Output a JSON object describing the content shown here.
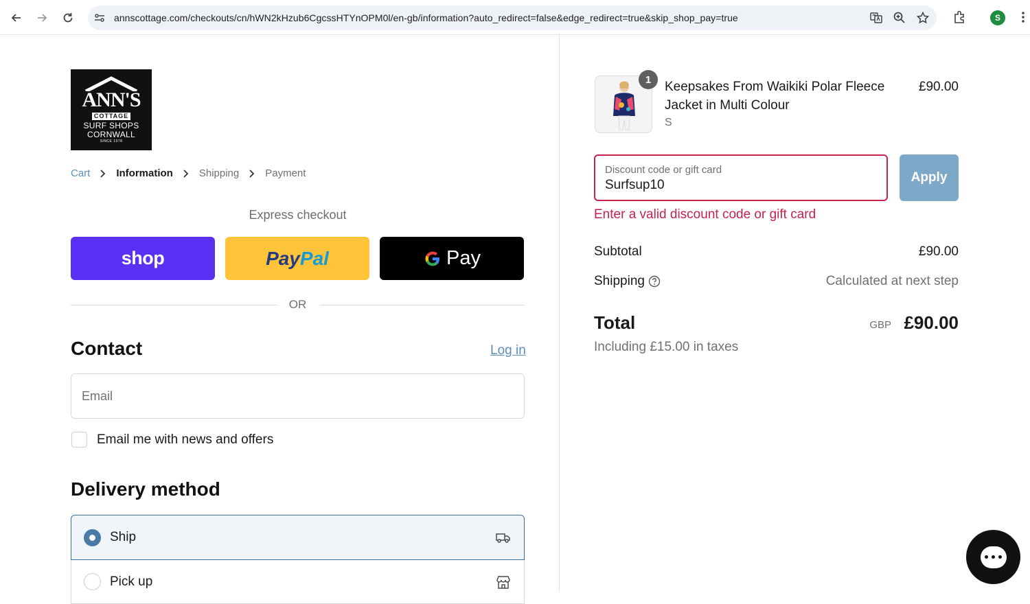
{
  "browser": {
    "url": "annscottage.com/checkouts/cn/hWN2kHzub6CgcssHTYnOPM0l/en-gb/information?auto_redirect=false&edge_redirect=true&skip_shop_pay=true",
    "profile_initial": "S"
  },
  "logo": {
    "brand": "ANN'S",
    "sub1": "COTTAGE",
    "sub2": "SURF SHOPS",
    "sub3": "CORNWALL",
    "since": "SINCE 1978"
  },
  "breadcrumb": {
    "items": [
      "Cart",
      "Information",
      "Shipping",
      "Payment"
    ]
  },
  "express": {
    "title": "Express checkout",
    "shop_label": "shop",
    "paypal_part1": "Pay",
    "paypal_part2": "Pal",
    "gpay_g": "G",
    "gpay_label": "Pay",
    "or": "OR"
  },
  "contact": {
    "title": "Contact",
    "login": "Log in",
    "email_placeholder": "Email",
    "newsletter_label": "Email me with news and offers"
  },
  "delivery": {
    "title": "Delivery method",
    "options": [
      {
        "label": "Ship",
        "selected": true
      },
      {
        "label": "Pick up",
        "selected": false
      }
    ]
  },
  "order": {
    "quantity": "1",
    "product_name": "Keepsakes From Waikiki Polar Fleece Jacket in Multi Colour",
    "variant": "S",
    "price": "£90.00",
    "discount_label": "Discount code or gift card",
    "discount_value": "Surfsup10",
    "apply_label": "Apply",
    "discount_error": "Enter a valid discount code or gift card",
    "subtotal_label": "Subtotal",
    "subtotal_value": "£90.00",
    "shipping_label": "Shipping",
    "shipping_value": "Calculated at next step",
    "total_label": "Total",
    "currency": "GBP",
    "total_value": "£90.00",
    "tax_note": "Including £15.00 in taxes"
  },
  "colors": {
    "shop_purple": "#5a31f4",
    "paypal_yellow": "#ffc439",
    "error_red": "#c7224d",
    "link_blue": "#5a8fb8"
  }
}
